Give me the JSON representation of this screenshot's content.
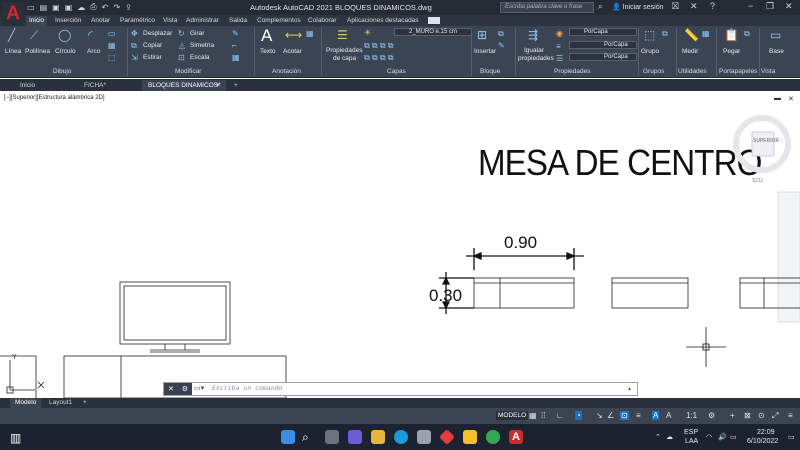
{
  "window": {
    "title": "Autodesk AutoCAD 2021   BLOQUES DINAMICOS.dwg",
    "search_placeholder": "Escriba palabra clave o frase",
    "signin_label": "Iniciar sesión",
    "logo": "A"
  },
  "ribbon_tabs": [
    "Inicio",
    "Inserción",
    "Anotar",
    "Paramétrico",
    "Vista",
    "Administrar",
    "Salida",
    "Complementos",
    "Colaborar",
    "Aplicaciones destacadas"
  ],
  "ribbon": {
    "draw": {
      "linea": "Línea",
      "polilinea": "Polilínea",
      "circulo": "Círculo",
      "arco": "Arco",
      "panel": "Dibujo"
    },
    "modify": {
      "desplazar": "Desplazar",
      "girar": "Girar",
      "copiar": "Copiar",
      "simetria": "Simetría",
      "estirar": "Estirar",
      "escala": "Escala",
      "panel": "Modificar"
    },
    "annotation": {
      "texto": "Texto",
      "acotar": "Acotar",
      "panel": "Anotación"
    },
    "layers": {
      "propiedades": "Propiedades",
      "de_capa": "de capa",
      "current_layer": "2_MURO e.15 cm",
      "panel": "Capas"
    },
    "block": {
      "insertar": "Insertar",
      "panel": "Bloque"
    },
    "properties": {
      "igualar": "Igualar",
      "propiedades": "propiedades",
      "color": "PorCapa",
      "linetype": "PorCapa",
      "lineweight": "PorCapa",
      "panel": "Propiedades"
    },
    "groups": {
      "grupo": "Grupo",
      "panel": "Grupos"
    },
    "utilities": {
      "medir": "Medir",
      "panel": "Utilidades"
    },
    "clipboard": {
      "pegar": "Pegar",
      "panel": "Portapapeles"
    },
    "view": {
      "base": "Base",
      "panel": "Vista"
    }
  },
  "file_tabs": {
    "start": "Inicio",
    "ficha": "FICHA*",
    "bloques": "BLOQUES DINAMICOS*"
  },
  "viewport": {
    "label": "[−][Superior][Estructura alámbrica 2D]",
    "viewcube_label": "SUPERIOR",
    "wcs_label": "SCU"
  },
  "drawing": {
    "title": "MESA DE CENTRO",
    "dim_width": "0.90",
    "dim_height": "0.30",
    "ucs_y": "Y",
    "ucs_x": "X"
  },
  "command_line": {
    "placeholder": "Escriba un comando"
  },
  "layout_tabs": [
    "Modelo",
    "Layout1"
  ],
  "status_bar": {
    "model": "MODELO",
    "scale": "1:1"
  },
  "taskbar": {
    "lang": "ESP",
    "lang2": "LAA",
    "time": "22:09",
    "date": "6/10/2022"
  }
}
